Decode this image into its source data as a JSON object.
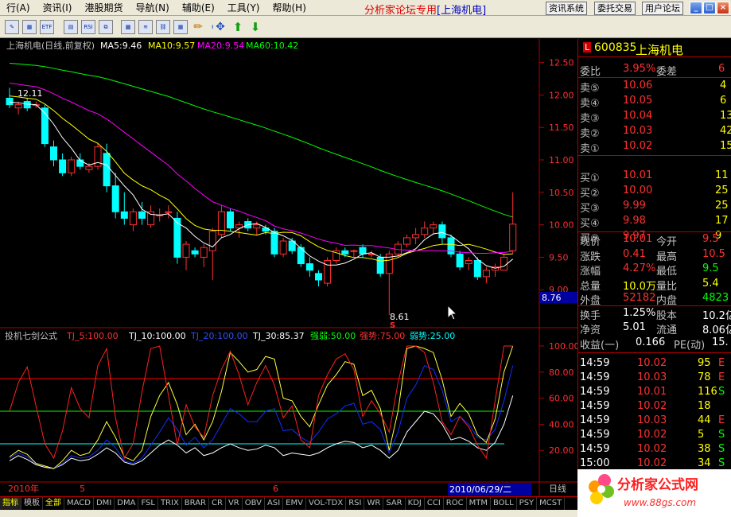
{
  "menus": [
    "行(A)",
    "资讯(I)",
    "港股期货",
    "导航(N)",
    "辅助(E)",
    "工具(Y)",
    "帮助(H)"
  ],
  "forum_title": "分析家论坛专用",
  "forum_subtitle": "[上海机电]",
  "top_buttons": [
    "资讯系统",
    "委托交易",
    "用户论坛"
  ],
  "toolbar_icons": [
    "draw-icon",
    "analysis-icon",
    "rsi-icon",
    "etf-icon",
    "chart-icon",
    "kline-icon",
    "pen-icon",
    "link-icon",
    "move-icon",
    "up-arrow-icon",
    "down-arrow-icon"
  ],
  "main_chart": {
    "legend": {
      "title": "上海机电(日线,前复权)",
      "ma5": "MA5:9.46",
      "ma10": "MA10:9.57",
      "ma20": "MA20:9.54",
      "ma60": "MA60:10.42"
    },
    "y_ticks": [
      "12.50",
      "12.00",
      "11.50",
      "11.00",
      "10.50",
      "10.00",
      "9.50",
      "9.00"
    ],
    "cursor_price": "8.76",
    "high_label": "12.11",
    "low_label": "8.61",
    "low_marker": "S"
  },
  "indicator": {
    "legend": {
      "name": "投机七剑公式",
      "tj5": "TJ_5:100.00",
      "tj10": "TJ_10:100.00",
      "tj20": "TJ_20:100.00",
      "tj30": "TJ_30:85.37",
      "rw": "强弱:50.00",
      "qs": "强势:75.00",
      "rs": "弱势:25.00"
    },
    "y_ticks": [
      "100.00",
      "80.00",
      "60.00",
      "40.00",
      "20.00"
    ]
  },
  "date_axis": {
    "year": "2010年",
    "m5": "5",
    "m6": "6",
    "cursor_date": "2010/06/29/二",
    "period": "日线"
  },
  "bottom_tabs": [
    "指标",
    "模板",
    "全部",
    "MACD",
    "DMI",
    "DMA",
    "FSL",
    "TRIX",
    "BRAR",
    "CR",
    "VR",
    "OBV",
    "ASI",
    "EMV",
    "VOL-TDX",
    "RSI",
    "WR",
    "SAR",
    "KDJ",
    "CCI",
    "ROC",
    "MTM",
    "BOLL",
    "PSY",
    "MCST"
  ],
  "quote": {
    "code": "600835",
    "name": "上海机电",
    "wb": {
      "label": "委比",
      "value": "3.95%",
      "label2": "委差",
      "value2": "6"
    },
    "sells": [
      {
        "l": "卖⑤",
        "p": "10.06",
        "v": "4"
      },
      {
        "l": "卖④",
        "p": "10.05",
        "v": "6"
      },
      {
        "l": "卖③",
        "p": "10.04",
        "v": "13"
      },
      {
        "l": "卖②",
        "p": "10.03",
        "v": "42"
      },
      {
        "l": "卖①",
        "p": "10.02",
        "v": "15"
      }
    ],
    "buys": [
      {
        "l": "买①",
        "p": "10.01",
        "v": "11"
      },
      {
        "l": "买②",
        "p": "10.00",
        "v": "25"
      },
      {
        "l": "买③",
        "p": "9.99",
        "v": "25"
      },
      {
        "l": "买④",
        "p": "9.98",
        "v": "17"
      },
      {
        "l": "买⑤",
        "p": "9.97",
        "v": "9"
      }
    ],
    "stats": [
      {
        "l1": "现价",
        "v1": "10.01",
        "l2": "今开",
        "v2": "9.5"
      },
      {
        "l1": "涨跌",
        "v1": "0.41",
        "l2": "最高",
        "v2": "10.5"
      },
      {
        "l1": "涨幅",
        "v1": "4.27%",
        "l2": "最低",
        "v2": "9.5"
      },
      {
        "l1": "总量",
        "v1": "10.0万",
        "l2": "量比",
        "v2": "5.4"
      },
      {
        "l1": "外盘",
        "v1": "52182",
        "l2": "内盘",
        "v2": "4823"
      },
      {
        "l1": "换手",
        "v1": "1.25%",
        "l2": "股本",
        "v2": "10.2亿"
      },
      {
        "l1": "净资",
        "v1": "5.01",
        "l2": "流通",
        "v2": "8.06亿"
      },
      {
        "l1": "收益(一)",
        "v1": "0.166",
        "l2": "PE(动)",
        "v2": "15."
      }
    ],
    "trades": [
      {
        "t": "14:59",
        "p": "10.02",
        "v": "95",
        "f": "E"
      },
      {
        "t": "14:59",
        "p": "10.03",
        "v": "78",
        "f": "E"
      },
      {
        "t": "14:59",
        "p": "10.01",
        "v": "116",
        "f": "S"
      },
      {
        "t": "14:59",
        "p": "10.02",
        "v": "18",
        "f": ""
      },
      {
        "t": "14:59",
        "p": "10.03",
        "v": "44",
        "f": "E"
      },
      {
        "t": "14:59",
        "p": "10.02",
        "v": "5",
        "f": "S"
      },
      {
        "t": "14:59",
        "p": "10.02",
        "v": "38",
        "f": "S"
      },
      {
        "t": "15:00",
        "p": "10.02",
        "v": "34",
        "f": "S"
      }
    ]
  },
  "watermark": {
    "title": "分析家公式网",
    "url": "www.88gs.com"
  },
  "colors": {
    "up": "#ff3030",
    "down": "#00ffff",
    "ma5": "#ffffff",
    "ma10": "#ffff00",
    "ma20": "#ff00ff",
    "ma60": "#00ff00"
  },
  "chart_data": [
    {
      "type": "candlestick",
      "title": "上海机电(日线,前复权)",
      "ylim": [
        9.0,
        12.6
      ],
      "series": [
        {
          "name": "上海机电",
          "ohlc": [
            [
              11.95,
              12.11,
              11.8,
              11.85
            ],
            [
              11.8,
              11.9,
              11.7,
              11.85
            ],
            [
              11.9,
              11.95,
              11.75,
              11.8
            ],
            [
              11.85,
              11.9,
              11.8,
              11.85
            ],
            [
              11.8,
              11.85,
              11.2,
              11.25
            ],
            [
              11.2,
              11.3,
              10.9,
              11.0
            ],
            [
              11.0,
              11.1,
              10.75,
              10.8
            ],
            [
              10.8,
              11.05,
              10.75,
              11.0
            ],
            [
              11.0,
              11.1,
              10.85,
              10.9
            ],
            [
              10.85,
              10.95,
              10.8,
              10.9
            ],
            [
              10.9,
              11.25,
              10.85,
              11.2
            ],
            [
              11.1,
              11.25,
              10.5,
              10.6
            ],
            [
              10.6,
              10.8,
              10.1,
              10.2
            ],
            [
              10.2,
              10.5,
              10.0,
              10.1
            ],
            [
              10.0,
              10.25,
              9.9,
              10.2
            ],
            [
              10.2,
              10.35,
              10.0,
              10.1
            ],
            [
              10.0,
              10.3,
              9.95,
              10.2
            ],
            [
              10.15,
              10.25,
              10.05,
              10.15
            ],
            [
              10.2,
              10.3,
              10.1,
              10.2
            ],
            [
              10.1,
              10.2,
              9.4,
              9.5
            ],
            [
              9.5,
              9.75,
              9.3,
              9.7
            ],
            [
              9.6,
              9.65,
              9.5,
              9.55
            ],
            [
              9.5,
              9.7,
              9.35,
              9.65
            ],
            [
              9.6,
              9.95,
              9.15,
              9.9
            ],
            [
              9.85,
              10.3,
              9.8,
              10.2
            ],
            [
              10.2,
              10.25,
              9.9,
              9.95
            ],
            [
              9.95,
              10.05,
              9.8,
              10.0
            ],
            [
              10.05,
              10.1,
              9.9,
              9.95
            ],
            [
              9.95,
              10.05,
              9.85,
              10.0
            ],
            [
              9.95,
              10.0,
              9.85,
              9.9
            ],
            [
              9.9,
              9.95,
              9.5,
              9.55
            ],
            [
              9.55,
              9.8,
              9.5,
              9.75
            ],
            [
              9.75,
              9.8,
              9.55,
              9.6
            ],
            [
              9.65,
              9.7,
              9.35,
              9.4
            ],
            [
              9.4,
              9.5,
              9.2,
              9.3
            ],
            [
              9.25,
              9.3,
              9.05,
              9.15
            ],
            [
              9.1,
              9.5,
              9.05,
              9.45
            ],
            [
              9.45,
              9.65,
              9.4,
              9.6
            ],
            [
              9.6,
              9.65,
              9.5,
              9.55
            ],
            [
              9.6,
              9.62,
              9.5,
              9.6
            ],
            [
              9.65,
              9.7,
              9.5,
              9.55
            ],
            [
              9.55,
              9.6,
              9.5,
              9.55
            ],
            [
              9.5,
              9.55,
              9.2,
              9.25
            ],
            [
              9.25,
              9.6,
              8.61,
              9.55
            ],
            [
              9.55,
              9.75,
              9.5,
              9.7
            ],
            [
              9.7,
              9.85,
              9.65,
              9.8
            ],
            [
              9.8,
              9.95,
              9.7,
              9.85
            ],
            [
              9.85,
              10.05,
              9.8,
              9.95
            ],
            [
              9.95,
              10.05,
              9.85,
              10.0
            ],
            [
              10.0,
              10.05,
              9.7,
              9.8
            ],
            [
              9.8,
              9.85,
              9.5,
              9.55
            ],
            [
              9.55,
              9.6,
              9.3,
              9.35
            ],
            [
              9.4,
              9.5,
              9.3,
              9.45
            ],
            [
              9.45,
              9.5,
              9.15,
              9.2
            ],
            [
              9.2,
              9.35,
              9.1,
              9.3
            ],
            [
              9.3,
              9.4,
              9.2,
              9.35
            ],
            [
              9.3,
              9.55,
              9.3,
              9.5
            ],
            [
              9.6,
              10.5,
              9.55,
              10.01
            ]
          ]
        }
      ]
    },
    {
      "type": "line",
      "title": "投机七剑公式",
      "ylim": [
        0,
        100
      ],
      "series": [
        {
          "name": "TJ_5",
          "values": [
            50,
            72,
            84,
            54,
            25,
            14,
            35,
            68,
            52,
            45,
            85,
            98,
            45,
            14,
            25,
            65,
            98,
            100,
            62,
            24,
            55,
            38,
            30,
            62,
            82,
            96,
            78,
            55,
            72,
            85,
            70,
            45,
            54,
            28,
            22,
            62,
            78,
            90,
            94,
            82,
            46,
            58,
            48,
            34,
            72,
            100,
            100,
            95,
            72,
            42,
            32,
            46,
            38,
            24,
            14,
            58,
            100,
            100
          ]
        },
        {
          "name": "TJ_10",
          "values": [
            15,
            20,
            17,
            10,
            8,
            6,
            12,
            20,
            16,
            18,
            28,
            42,
            30,
            15,
            12,
            20,
            46,
            62,
            72,
            55,
            32,
            40,
            28,
            42,
            65,
            95,
            88,
            80,
            82,
            92,
            90,
            60,
            58,
            46,
            38,
            55,
            70,
            78,
            88,
            86,
            62,
            66,
            52,
            20,
            50,
            98,
            100,
            98,
            95,
            74,
            46,
            56,
            48,
            32,
            26,
            44,
            80,
            100
          ]
        },
        {
          "name": "TJ_20",
          "values": [
            14,
            18,
            15,
            10,
            8,
            6,
            10,
            16,
            14,
            15,
            20,
            28,
            22,
            12,
            10,
            14,
            24,
            34,
            45,
            36,
            24,
            30,
            22,
            28,
            40,
            52,
            48,
            42,
            42,
            50,
            52,
            35,
            36,
            30,
            26,
            34,
            44,
            48,
            54,
            56,
            40,
            42,
            36,
            18,
            34,
            60,
            70,
            85,
            82,
            66,
            42,
            46,
            40,
            30,
            28,
            36,
            58,
            85
          ]
        },
        {
          "name": "TJ_30",
          "values": [
            12,
            16,
            13,
            9,
            7,
            6,
            9,
            14,
            12,
            13,
            17,
            22,
            18,
            11,
            9,
            12,
            18,
            24,
            28,
            24,
            18,
            22,
            16,
            18,
            22,
            25,
            22,
            20,
            21,
            24,
            22,
            16,
            18,
            17,
            16,
            18,
            22,
            25,
            27,
            26,
            22,
            24,
            20,
            14,
            20,
            34,
            42,
            50,
            48,
            40,
            28,
            30,
            27,
            22,
            20,
            26,
            40,
            62
          ]
        },
        {
          "name": "强弱",
          "values": [
            50
          ]
        },
        {
          "name": "强势",
          "values": [
            75
          ]
        },
        {
          "name": "弱势",
          "values": [
            25
          ]
        }
      ]
    }
  ]
}
